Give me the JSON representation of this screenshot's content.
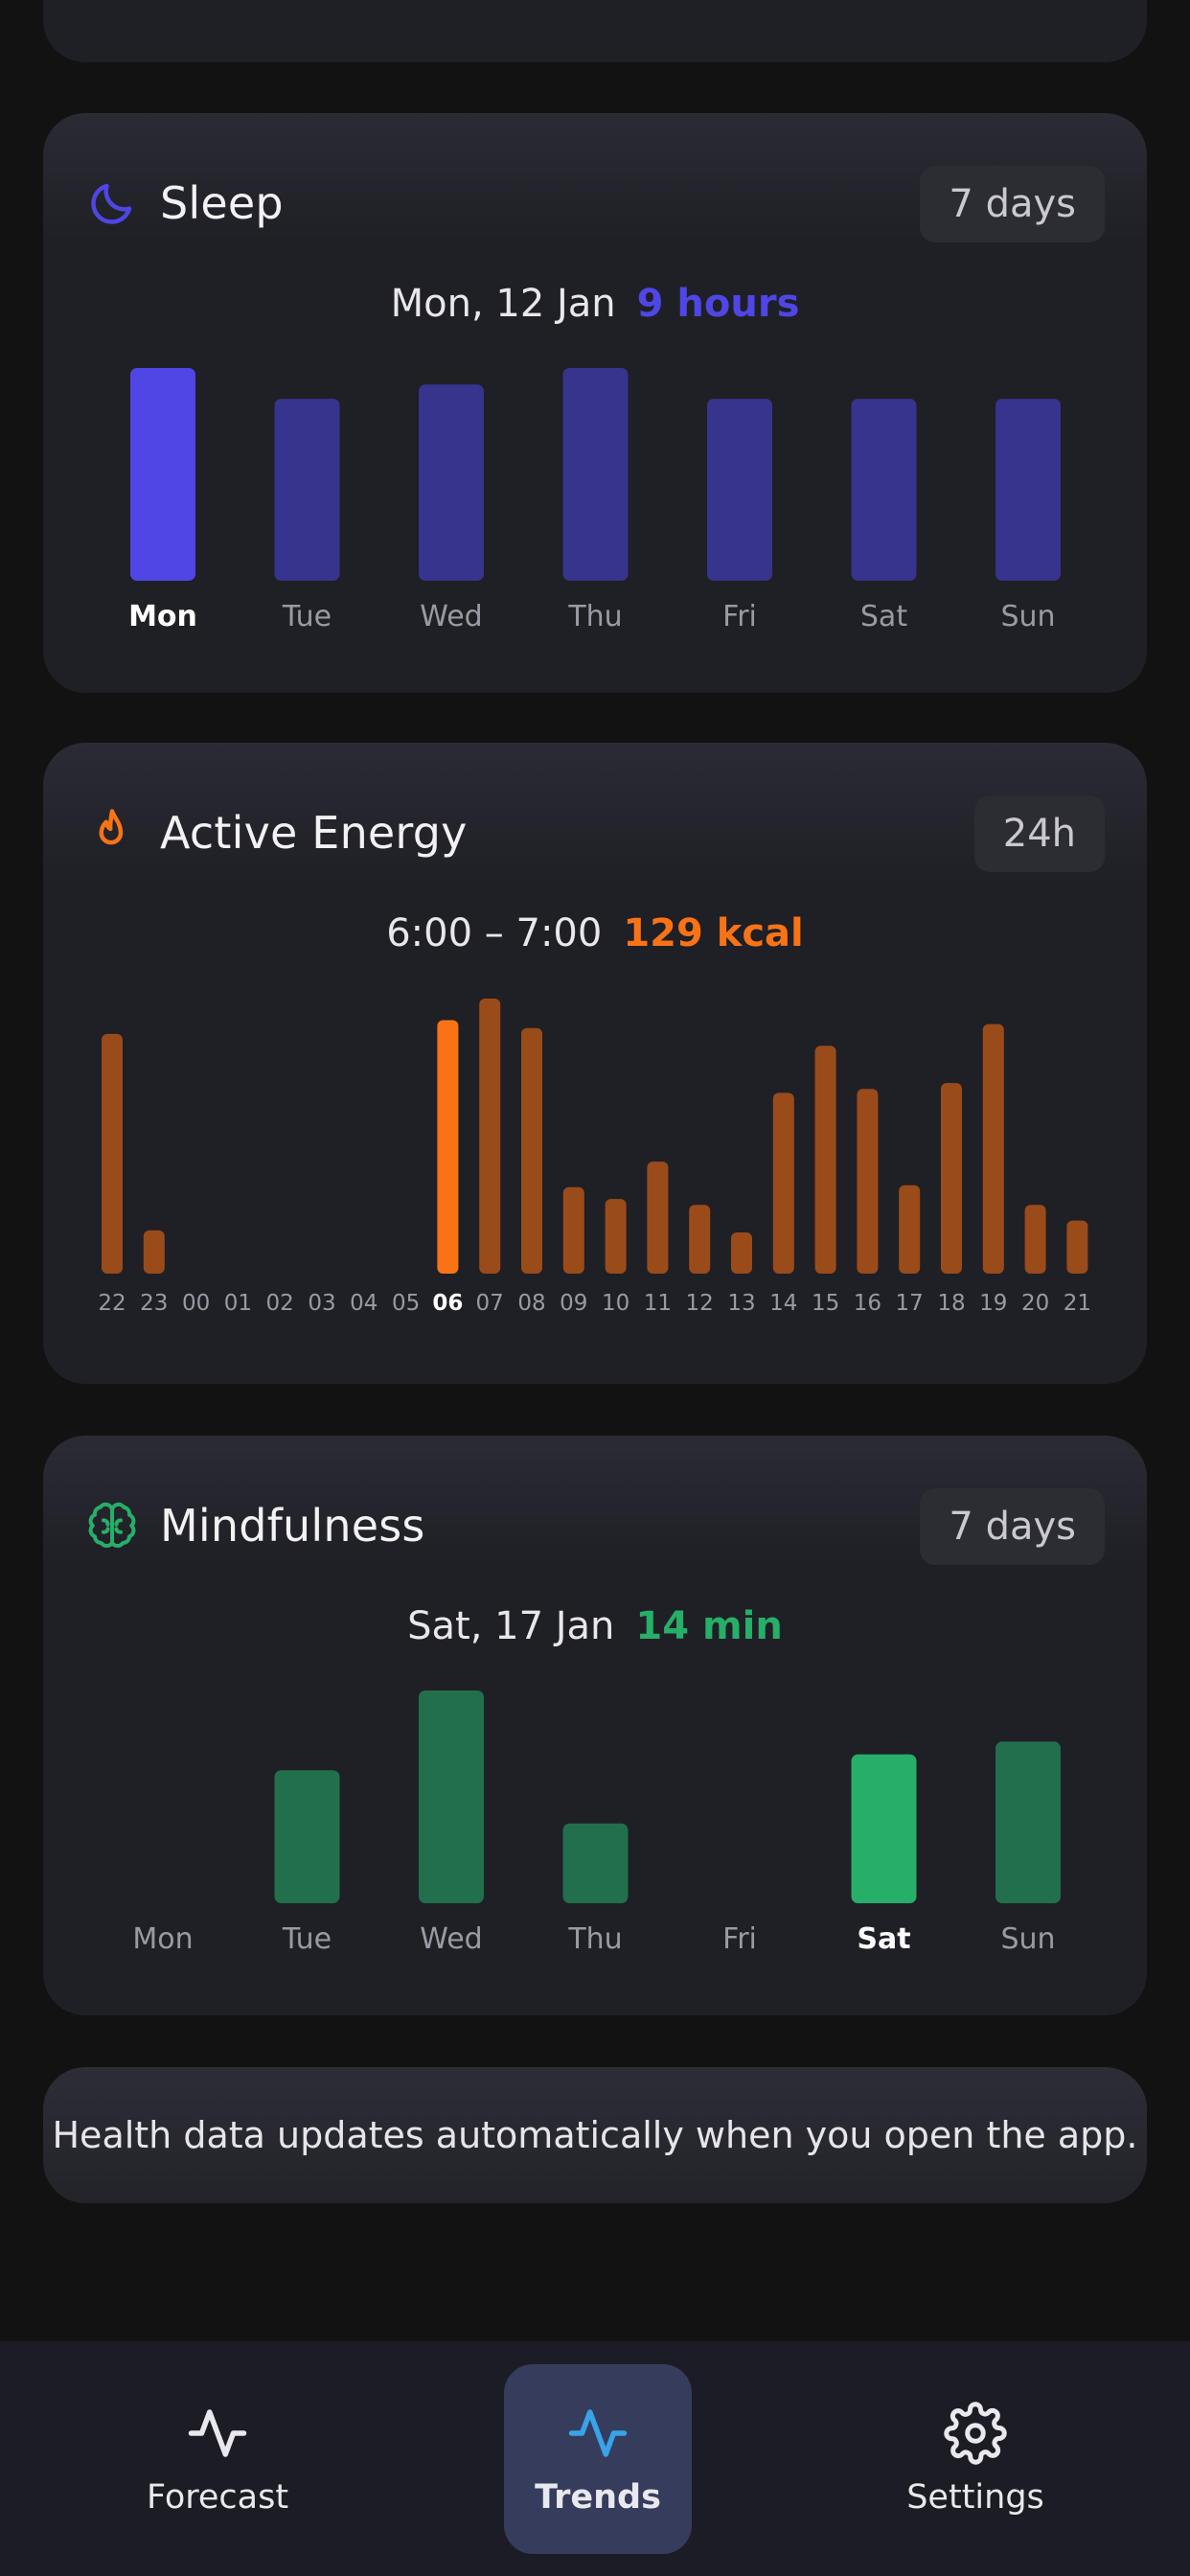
{
  "sleep": {
    "title": "Sleep",
    "range": "7 days",
    "summary_label": "Mon, 12 Jan",
    "summary_value": "9 hours",
    "accent": "#4f46e5",
    "dim": "#36348c",
    "selected_index": 0
  },
  "energy": {
    "title": "Active Energy",
    "range": "24h",
    "summary_label": "6:00 – 7:00",
    "summary_value": "129 kcal",
    "accent": "#f97316",
    "dim": "#9a4b1a",
    "selected_index": 8
  },
  "mindfulness": {
    "title": "Mindfulness",
    "range": "7 days",
    "summary_label": "Sat, 17 Jan",
    "summary_value": "14 min",
    "accent": "#27ae68",
    "dim": "#226f4c",
    "selected_index": 5
  },
  "note": {
    "text": "Health data updates automatically when you open the app."
  },
  "nav": {
    "items": [
      {
        "label": "Forecast",
        "icon": "activity-icon",
        "active": false
      },
      {
        "label": "Trends",
        "icon": "activity-icon",
        "active": true
      },
      {
        "label": "Settings",
        "icon": "gear-icon",
        "active": false
      }
    ],
    "active_color": "#38a3e8"
  },
  "chart_data": [
    {
      "type": "bar",
      "categories": [
        "Mon",
        "Tue",
        "Wed",
        "Thu",
        "Fri",
        "Sat",
        "Sun"
      ],
      "values": [
        9.0,
        7.7,
        8.3,
        9.0,
        7.7,
        7.7,
        7.7
      ],
      "title": "Sleep",
      "ylim": [
        0,
        9
      ]
    },
    {
      "type": "bar",
      "categories": [
        "22",
        "23",
        "00",
        "01",
        "02",
        "03",
        "04",
        "05",
        "06",
        "07",
        "08",
        "09",
        "10",
        "11",
        "12",
        "13",
        "14",
        "15",
        "16",
        "17",
        "18",
        "19",
        "20",
        "21"
      ],
      "values": [
        122,
        22,
        0,
        0,
        0,
        0,
        0,
        0,
        129,
        140,
        125,
        44,
        38,
        57,
        35,
        21,
        92,
        116,
        94,
        45,
        97,
        127,
        35,
        27
      ],
      "title": "Active Energy",
      "ylim": [
        0,
        140
      ]
    },
    {
      "type": "bar",
      "categories": [
        "Mon",
        "Tue",
        "Wed",
        "Thu",
        "Fri",
        "Sat",
        "Sun"
      ],
      "values": [
        0,
        12.5,
        20,
        7.5,
        0,
        14,
        15.2
      ],
      "title": "Mindfulness",
      "ylim": [
        0,
        20
      ]
    }
  ]
}
